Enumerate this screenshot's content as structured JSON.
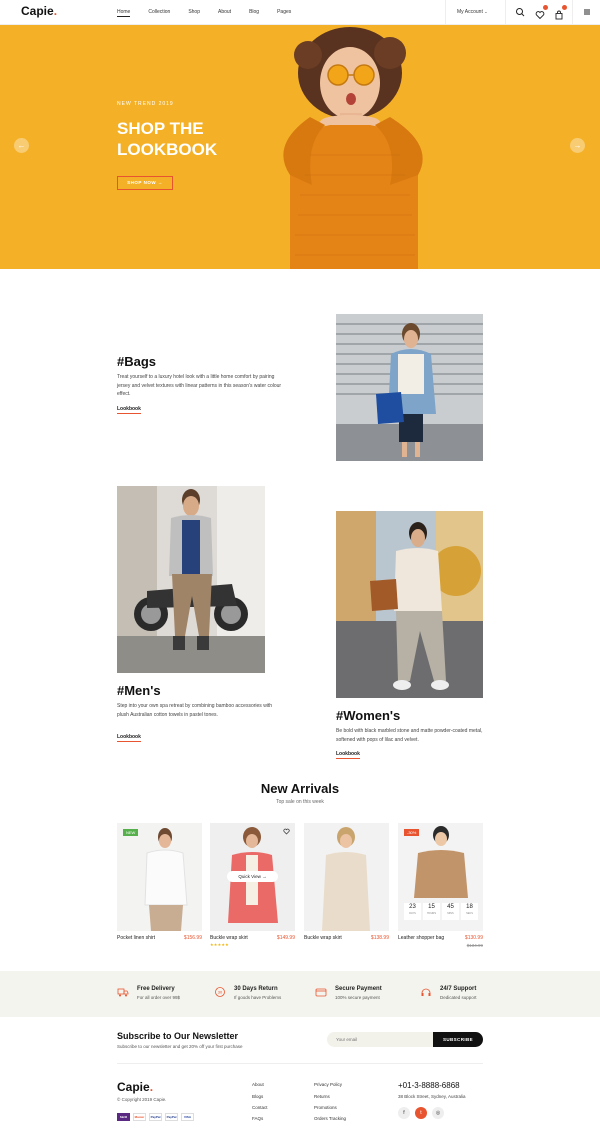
{
  "header": {
    "logo_text": "Capie",
    "logo_dot": ".",
    "nav": [
      {
        "label": "Home"
      },
      {
        "label": "Collection"
      },
      {
        "label": "Shop"
      },
      {
        "label": "About"
      },
      {
        "label": "Blog"
      },
      {
        "label": "Pages"
      }
    ],
    "account_label": "My Account",
    "icons": [
      "search-icon",
      "heart-icon",
      "bag-icon",
      "menu-icon"
    ]
  },
  "hero": {
    "tag": "NEW TREND 2019",
    "title": "SHOP THE LOOKBOOK",
    "button": "SHOP NOW →",
    "bg_color": "#f4b128",
    "prev_arrow": "←",
    "next_arrow": "→"
  },
  "lookbook": [
    {
      "title": "#Bags",
      "text": "Treat yourself to a luxury hotel look with a little home comfort by pairing jersey and velvet textures with linear patterns in this season's water colour effect.",
      "link": "Lookbook"
    },
    {
      "title": "#Men's",
      "text": "Step into your own spa retreat by combining bamboo accessories with plush Australian cotton towels in pastel tones.",
      "link": "Lookbook"
    },
    {
      "title": "#Women's",
      "text": "Be bold with black marbled stone and matte powder-coated metal, softened with pops of lilac and velvet.",
      "link": "Lookbook"
    }
  ],
  "arrivals": {
    "title": "New Arrivals",
    "subtitle": "Top sale on this week",
    "products": [
      {
        "name": "Pocket linen shirt",
        "price": "$156.99",
        "badge": "NEW"
      },
      {
        "name": "Buckle wrap skirt",
        "price": "$149.99",
        "quick_view": "Quick View →",
        "rating": 5
      },
      {
        "name": "Buckle wrap skirt",
        "price": "$138.99"
      },
      {
        "name": "Leather shopper bag",
        "price": "$130.99",
        "old_price": "$134.99",
        "badge": "-30%",
        "countdown": [
          {
            "v": "23",
            "l": "DAYS"
          },
          {
            "v": "15",
            "l": "HOURS"
          },
          {
            "v": "45",
            "l": "MINS"
          },
          {
            "v": "18",
            "l": "SECS"
          }
        ]
      }
    ]
  },
  "features": [
    {
      "title": "Free Delivery",
      "sub": "For all order over 99$",
      "icon": "truck-icon"
    },
    {
      "title": "30 Days Return",
      "sub": "If goods have Problems",
      "icon": "return-icon"
    },
    {
      "title": "Secure Payment",
      "sub": "100% secure payment",
      "icon": "card-icon"
    },
    {
      "title": "24/7 Support",
      "sub": "Dedicated support",
      "icon": "support-icon"
    }
  ],
  "newsletter": {
    "title": "Subscribe to Our Newsletter",
    "sub": "Subscribe to our newsletter and get 20% off your first purchase",
    "placeholder": "Your email",
    "button": "SUBSCRIBE"
  },
  "footer": {
    "logo_text": "Capie",
    "copyright": "© Copyright 2019 Capie.",
    "payments": [
      "Skrill",
      "Master",
      "PayPal",
      "PayPal",
      "VISA"
    ],
    "links_col1": [
      "About",
      "Blogs",
      "Contact",
      "FAQs"
    ],
    "links_col2": [
      "Privacy Policy",
      "Returns",
      "Promotions",
      "Orders Tracking"
    ],
    "phone": "+01-3-8888-6868",
    "address": "38 Block Street, Sydney, Australia",
    "social": [
      "f",
      "t",
      "◎"
    ]
  },
  "colors": {
    "accent": "#e8542f",
    "hero": "#f4b128"
  }
}
